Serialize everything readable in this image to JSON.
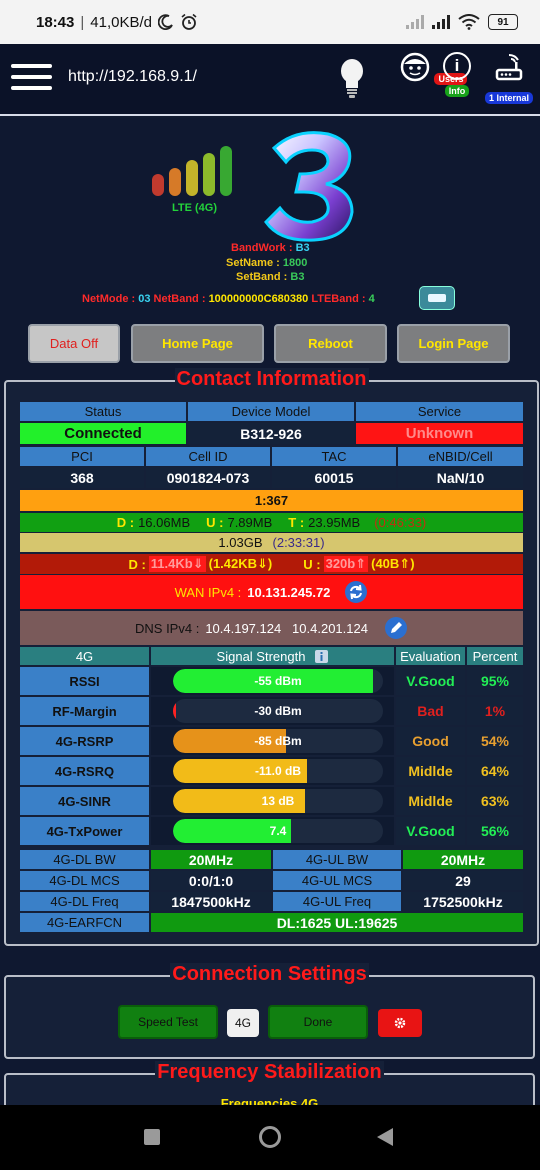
{
  "statusbar": {
    "time": "18:43",
    "speed": "41,0KB/d",
    "battery": "91",
    "icons": [
      "moon-icon",
      "alarm-icon",
      "signal-icon",
      "signal-icon",
      "wifi-icon",
      "battery-icon"
    ]
  },
  "header": {
    "url": "http://192.168.9.1/",
    "users_label": "Users",
    "info_label": "Info",
    "internal_label": "1 Internal",
    "info_glyph": "i"
  },
  "device": {
    "lte_label": "LTE (4G)",
    "bandwork_label": "BandWork :",
    "bandwork_value": "B3",
    "setname_label": "SetName :",
    "setname_value": "1800",
    "setband_label": "SetBand :",
    "setband_value": "B3",
    "netmode_label": "NetMode :",
    "netmode_value": "03",
    "netband_label": "NetBand :",
    "netband_value": "100000000C680380",
    "lteband_label": "LTEBand :",
    "lteband_value": "4"
  },
  "buttons": {
    "data_off": "Data Off",
    "home_page": "Home Page",
    "reboot": "Reboot",
    "login_page": "Login Page"
  },
  "contact": {
    "legend": "Contact Information",
    "status_hdr": "Status",
    "model_hdr": "Device Model",
    "service_hdr": "Service",
    "status_val": "Connected",
    "model_val": "B312-926",
    "service_val": "Unknown",
    "pci_hdr": "PCI",
    "cellid_hdr": "Cell ID",
    "tac_hdr": "TAC",
    "enbid_hdr": "eNBID/Cell",
    "pci_val": "368",
    "cellid_val": "0901824-073",
    "tac_val": "60015",
    "enbid_val": "NaN/10",
    "ratio": "1:367",
    "d_label": "D :",
    "d_val": "16.06MB",
    "u_label": "U :",
    "u_val": "7.89MB",
    "t_label": "T :",
    "t_val": "23.95MB",
    "t_time": "(0:46:33)",
    "total": "1.03GB",
    "total_time": "(2:33:31)",
    "rate_d_label": "D :",
    "rate_d": "11.4Kb⇓",
    "rate_d2": "(1.42KB⇓)",
    "rate_u_label": "U :",
    "rate_u": "320b⇑",
    "rate_u2": "(40B⇑)",
    "wan_label": "WAN IPv4 :",
    "wan_val": "10.131.245.72",
    "dns_label": "DNS IPv4 :",
    "dns_val": "10.4.197.124   10.4.201.124"
  },
  "signal": {
    "col_4g": "4G",
    "col_strength": "Signal Strength",
    "col_eval": "Evaluation",
    "col_percent": "Percent",
    "rows": [
      {
        "name": "RSSI",
        "value": "-55 dBm",
        "eval": "V.Good",
        "percent": "95%",
        "fill": 0.95,
        "color": "#22ee33",
        "eval_color": "#22ee55"
      },
      {
        "name": "RF-Margin",
        "value": "-30 dBm",
        "eval": "Bad",
        "percent": "1%",
        "fill": 0.01,
        "color": "#ff2222",
        "eval_color": "#e0201e"
      },
      {
        "name": "4G-RSRP",
        "value": "-85 dBm",
        "eval": "Good",
        "percent": "54%",
        "fill": 0.54,
        "color": "#e6921a",
        "eval_color": "#e8a030"
      },
      {
        "name": "4G-RSRQ",
        "value": "-11.0 dB",
        "eval": "Midlde",
        "percent": "64%",
        "fill": 0.64,
        "color": "#f2bb18",
        "eval_color": "#f0c020"
      },
      {
        "name": "4G-SINR",
        "value": "13 dB",
        "eval": "Midlde",
        "percent": "63%",
        "fill": 0.63,
        "color": "#f2bb18",
        "eval_color": "#f0c020"
      },
      {
        "name": "4G-TxPower",
        "value": "7.4",
        "eval": "V.Good",
        "percent": "56%",
        "fill": 0.56,
        "color": "#22ee33",
        "eval_color": "#22ee55"
      }
    ],
    "dl_bw_label": "4G-DL BW",
    "dl_bw": "20MHz",
    "ul_bw_label": "4G-UL BW",
    "ul_bw": "20MHz",
    "dl_mcs_label": "4G-DL MCS",
    "dl_mcs": "0:0/1:0",
    "ul_mcs_label": "4G-UL MCS",
    "ul_mcs": "29",
    "dl_freq_label": "4G-DL Freq",
    "dl_freq": "1847500kHz",
    "ul_freq_label": "4G-UL Freq",
    "ul_freq": "1752500kHz",
    "earfcn_label": "4G-EARFCN",
    "earfcn": "DL:1625 UL:19625"
  },
  "connection": {
    "legend": "Connection Settings",
    "speed_test": "Speed Test",
    "mode": "4G",
    "done": "Done"
  },
  "frequency": {
    "legend": "Frequency Stabilization",
    "sub_legend": "Frequencies 4G"
  }
}
